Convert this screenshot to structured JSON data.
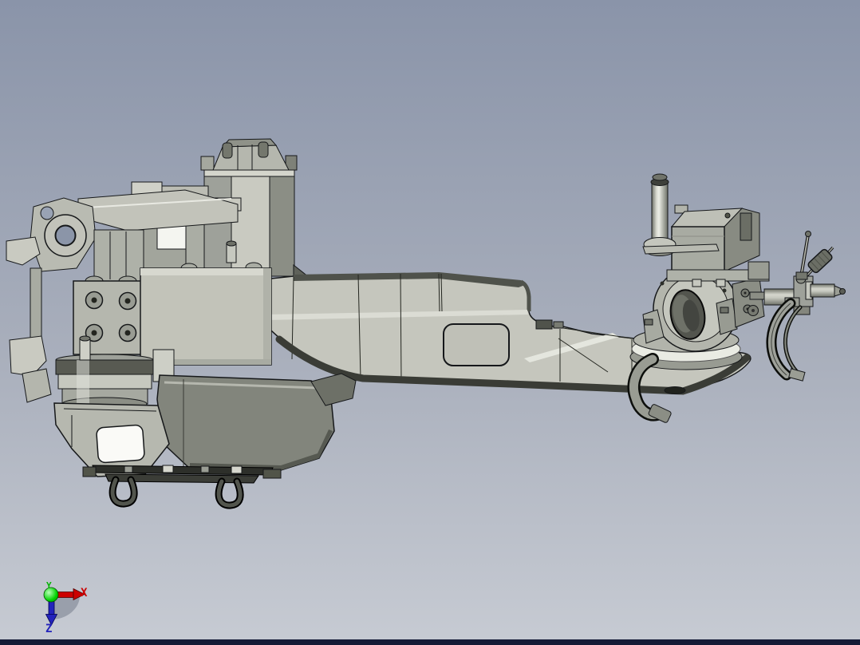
{
  "app": {
    "type": "3d-cad-viewport",
    "description": "Gray shaded CAD assembly (horizontal machine head with long arm, turret flange, spindle and lifting rings) viewed from the side"
  },
  "viewport": {
    "background_top": "#8a94a9",
    "background_bottom": "#c7cbd3",
    "bottom_border_color": "#151b36",
    "model_light": "#c7c8bf",
    "model_mid": "#b2b4ab",
    "model_shadow": "#8b8e85",
    "model_dark": "#3c3e38",
    "outline_color": "#16181a",
    "white_panel": "#fafaf7"
  },
  "axis_triad": {
    "x_label": "X",
    "y_label": "Y",
    "z_label": "Z",
    "x_color": "#cc0000",
    "y_color": "#00b400",
    "z_color": "#2323bb",
    "origin_color": "#00c800",
    "shadow_color": "#8e95a1"
  }
}
